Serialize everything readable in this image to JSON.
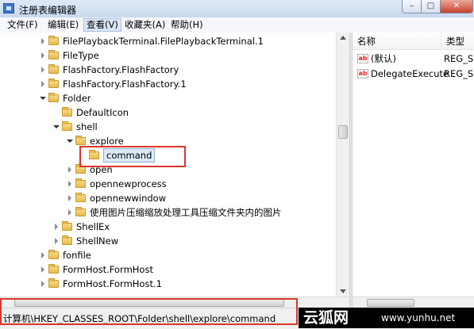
{
  "window": {
    "title": "注册表编辑器"
  },
  "window_buttons": {
    "minimize": "–",
    "maximize": "□",
    "close": "✕"
  },
  "menubar": [
    {
      "label": "文件(F)"
    },
    {
      "label": "编辑(E)"
    },
    {
      "label": "查看(V)",
      "active": true
    },
    {
      "label": "收藏夹(A)"
    },
    {
      "label": "帮助(H)"
    }
  ],
  "tree": [
    {
      "label": "FilePlaybackTerminal.FilePlaybackTerminal.1",
      "depth": 0,
      "expander": "right"
    },
    {
      "label": "FileType",
      "depth": 0,
      "expander": "right"
    },
    {
      "label": "FlashFactory.FlashFactory",
      "depth": 0,
      "expander": "right"
    },
    {
      "label": "FlashFactory.FlashFactory.1",
      "depth": 0,
      "expander": "right"
    },
    {
      "label": "Folder",
      "depth": 0,
      "expander": "down"
    },
    {
      "label": "DefaultIcon",
      "depth": 1,
      "expander": "none"
    },
    {
      "label": "shell",
      "depth": 1,
      "expander": "down"
    },
    {
      "label": "explore",
      "depth": 2,
      "expander": "down"
    },
    {
      "label": "command",
      "depth": 3,
      "expander": "none",
      "selected": true
    },
    {
      "label": "open",
      "depth": 2,
      "expander": "right"
    },
    {
      "label": "opennewprocess",
      "depth": 2,
      "expander": "right"
    },
    {
      "label": "opennewwindow",
      "depth": 2,
      "expander": "right"
    },
    {
      "label": "使用图片压缩缩放处理工具压缩文件夹内的图片",
      "depth": 2,
      "expander": "right"
    },
    {
      "label": "ShellEx",
      "depth": 1,
      "expander": "right"
    },
    {
      "label": "ShellNew",
      "depth": 1,
      "expander": "right"
    },
    {
      "label": "fonfile",
      "depth": 0,
      "expander": "right"
    },
    {
      "label": "FormHost.FormHost",
      "depth": 0,
      "expander": "right"
    },
    {
      "label": "FormHost.FormHost.1",
      "depth": 0,
      "expander": "right"
    }
  ],
  "list": {
    "headers": {
      "name": "名称",
      "type": "类型"
    },
    "rows": [
      {
        "icon": "ab",
        "name": "(默认)",
        "type": "REG_S"
      },
      {
        "icon": "ab",
        "name": "DelegateExecute",
        "type": "REG_S"
      }
    ]
  },
  "statusbar": {
    "path": "计算机\\HKEY_CLASSES_ROOT\\Folder\\shell\\explore\\command"
  },
  "watermark": {
    "site_name": "云狐网",
    "url": "www.yunhu.net"
  },
  "colors": {
    "highlight_box": "#d9362b",
    "selection": "#dce9f8"
  }
}
